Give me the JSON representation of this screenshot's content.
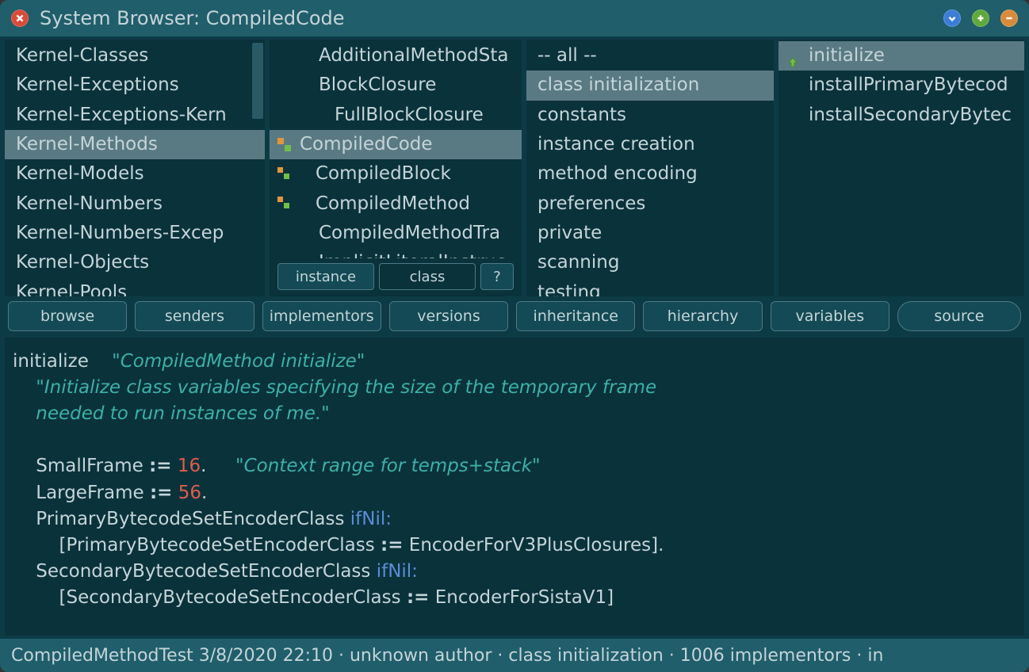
{
  "window": {
    "title": "System Browser: CompiledCode"
  },
  "categories": {
    "items": [
      {
        "label": "Kernel-Classes"
      },
      {
        "label": "Kernel-Exceptions"
      },
      {
        "label": "Kernel-Exceptions-Kern"
      },
      {
        "label": "Kernel-Methods"
      },
      {
        "label": "Kernel-Models"
      },
      {
        "label": "Kernel-Numbers"
      },
      {
        "label": "Kernel-Numbers-Excep"
      },
      {
        "label": "Kernel-Objects"
      },
      {
        "label": "Kernel-Pools"
      }
    ],
    "selected_index": 3
  },
  "classes": {
    "items": [
      {
        "label": "AdditionalMethodSta",
        "indent": 1,
        "icon": null
      },
      {
        "label": "BlockClosure",
        "indent": 1,
        "icon": null
      },
      {
        "label": "FullBlockClosure",
        "indent": 2,
        "icon": null
      },
      {
        "label": "CompiledCode",
        "indent": 1,
        "icon": "class"
      },
      {
        "label": "CompiledBlock",
        "indent": 2,
        "icon": "class"
      },
      {
        "label": "CompiledMethod",
        "indent": 2,
        "icon": "class"
      },
      {
        "label": "CompiledMethodTra",
        "indent": 1,
        "icon": null
      },
      {
        "label": "ImplicitLiteralInstruc",
        "indent": 1,
        "icon": null
      }
    ],
    "selected_index": 3,
    "switch": {
      "instance": "instance",
      "class": "class",
      "help": "?",
      "active": "class"
    }
  },
  "protocols": {
    "items": [
      {
        "label": "-- all --"
      },
      {
        "label": "class initialization"
      },
      {
        "label": "constants"
      },
      {
        "label": "instance creation"
      },
      {
        "label": "method encoding"
      },
      {
        "label": "preferences"
      },
      {
        "label": "private"
      },
      {
        "label": "scanning"
      },
      {
        "label": "testing"
      }
    ],
    "selected_index": 1
  },
  "methods": {
    "items": [
      {
        "label": "initialize",
        "icon": "arrow-up"
      },
      {
        "label": "installPrimaryBytecod",
        "icon": null
      },
      {
        "label": "installSecondaryBytec",
        "icon": null
      }
    ],
    "selected_index": 0
  },
  "toolbar": {
    "browse": "browse",
    "senders": "senders",
    "implementors": "implementors",
    "versions": "versions",
    "inheritance": "inheritance",
    "hierarchy": "hierarchy",
    "variables": "variables",
    "source": "source"
  },
  "code": {
    "selector": "initialize",
    "comment_inline": "\"CompiledMethod initialize\"",
    "comment_block_1": "\"Initialize class variables specifying the size of the temporary frame",
    "comment_block_2": "needed to run instances of me.\"",
    "line1_var": "SmallFrame ",
    "assign": ":=",
    "line1_val": " 16",
    "dot": ".",
    "line1_comment": "\"Context range for temps+stack\"",
    "line2_var": "LargeFrame ",
    "line2_val": " 56",
    "line3_a": "PrimaryBytecodeSetEncoderClass ",
    "ifNil": "ifNil:",
    "line3_b": "[PrimaryBytecodeSetEncoderClass ",
    "line3_c": " EncoderForV3PlusClosures].",
    "line4_a": "SecondaryBytecodeSetEncoderClass ",
    "line4_b": "[SecondaryBytecodeSetEncoderClass ",
    "line4_c": " EncoderForSistaV1]"
  },
  "status": {
    "text": "CompiledMethodTest 3/8/2020 22:10 · unknown author · class initialization · 1006 implementors · in"
  }
}
